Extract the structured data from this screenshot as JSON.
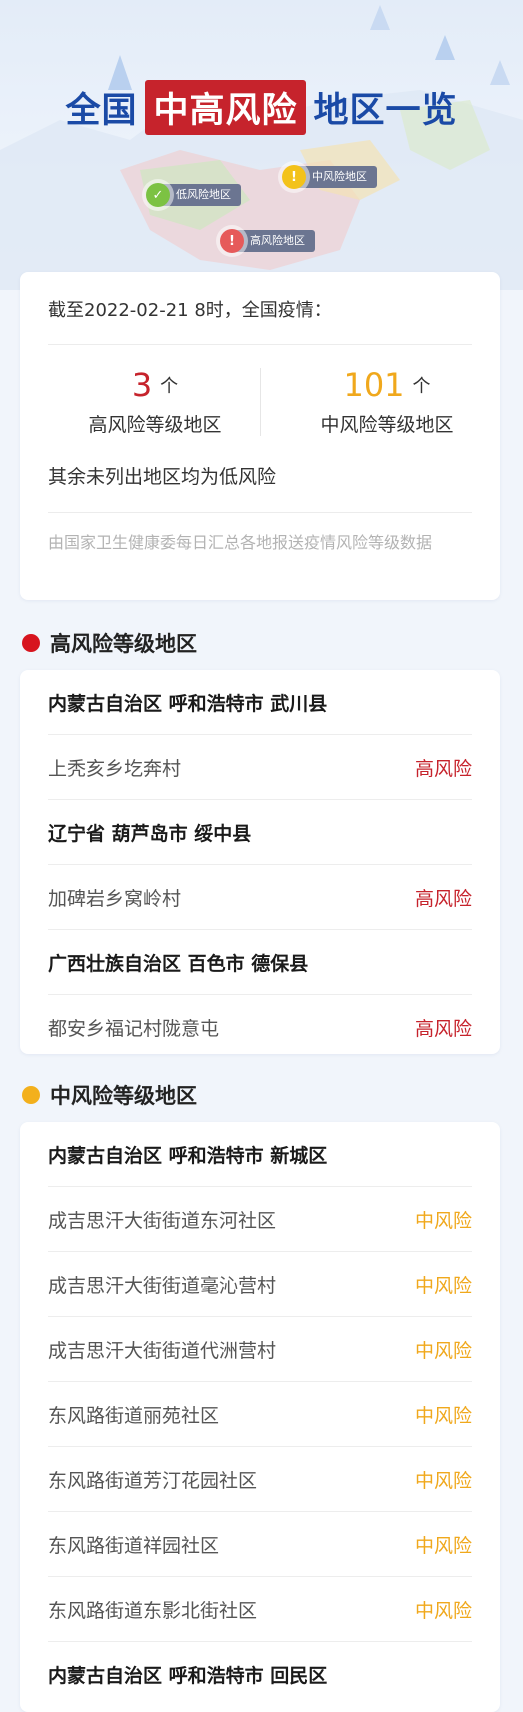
{
  "header": {
    "title_pre": "全国",
    "title_highlight": "中高风险",
    "title_post": "地区一览",
    "legend": {
      "low": "低风险地区",
      "mid": "中风险地区",
      "high": "高风险地区"
    }
  },
  "summary": {
    "date_text": "截至2022-02-21 8时，全国疫情：",
    "high": {
      "count": "3",
      "unit": "个",
      "caption": "高风险等级地区"
    },
    "mid": {
      "count": "101",
      "unit": "个",
      "caption": "中风险等级地区"
    },
    "rest_text": "其余未列出地区均为低风险",
    "source_note": "由国家卫生健康委每日汇总各地报送疫情风险等级数据"
  },
  "colors": {
    "high": "#c6232c",
    "mid": "#f0a81c",
    "low": "#7cc243",
    "title_blue": "#1a4aa6"
  },
  "sections": {
    "high": {
      "title": "高风险等级地区",
      "groups": [
        {
          "region": "内蒙古自治区 呼和浩特市 武川县",
          "places": [
            {
              "name": "上秃亥乡圪奔村",
              "risk": "高风险"
            }
          ]
        },
        {
          "region": "辽宁省 葫芦岛市 绥中县",
          "places": [
            {
              "name": "加碑岩乡窝岭村",
              "risk": "高风险"
            }
          ]
        },
        {
          "region": "广西壮族自治区 百色市 德保县",
          "places": [
            {
              "name": "都安乡福记村陇意屯",
              "risk": "高风险"
            }
          ]
        }
      ]
    },
    "mid": {
      "title": "中风险等级地区",
      "groups": [
        {
          "region": "内蒙古自治区 呼和浩特市 新城区",
          "places": [
            {
              "name": "成吉思汗大街街道东河社区",
              "risk": "中风险"
            },
            {
              "name": "成吉思汗大街街道毫沁营村",
              "risk": "中风险"
            },
            {
              "name": "成吉思汗大街街道代洲营村",
              "risk": "中风险"
            },
            {
              "name": "东风路街道丽苑社区",
              "risk": "中风险"
            },
            {
              "name": "东风路街道芳汀花园社区",
              "risk": "中风险"
            },
            {
              "name": "东风路街道祥园社区",
              "risk": "中风险"
            },
            {
              "name": "东风路街道东影北街社区",
              "risk": "中风险"
            }
          ]
        },
        {
          "region": "内蒙古自治区 呼和浩特市 回民区",
          "places": []
        }
      ]
    }
  }
}
